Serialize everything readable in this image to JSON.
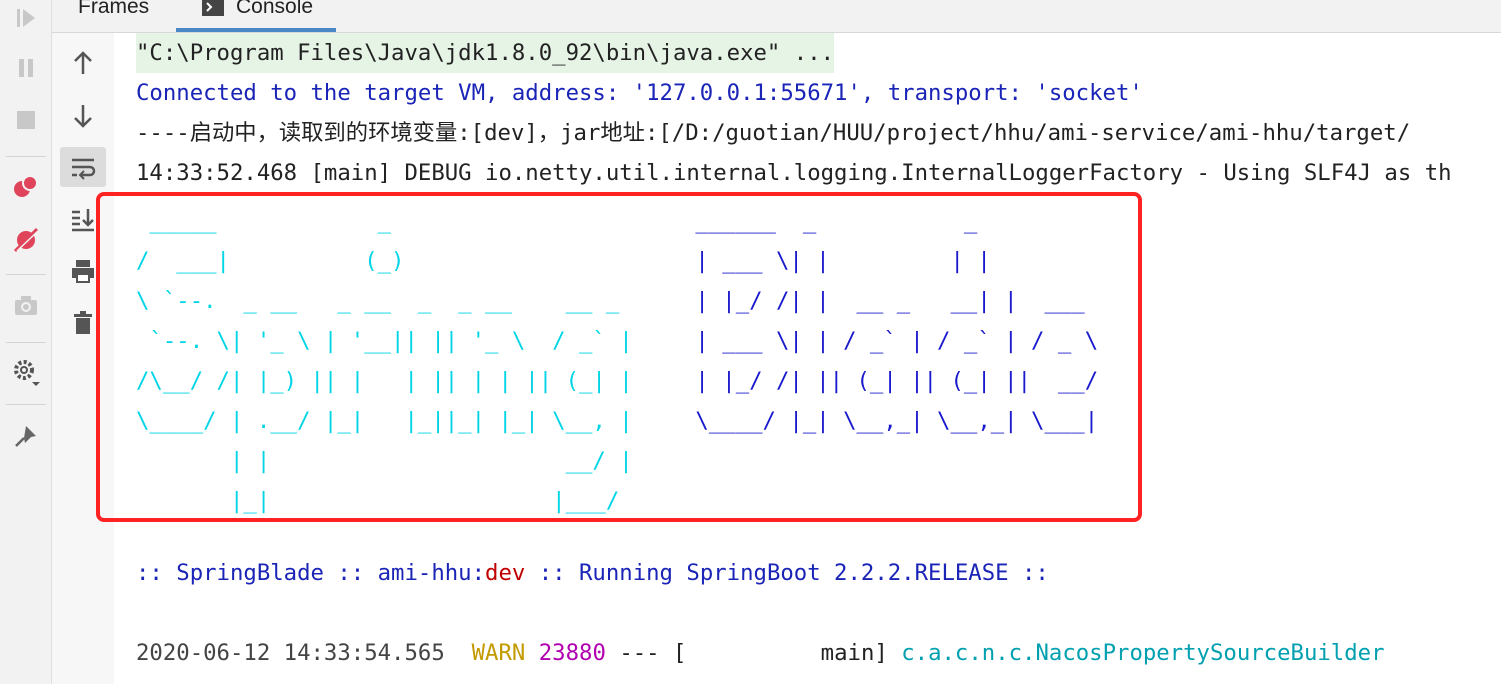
{
  "tabs": [
    {
      "label": "Frames"
    },
    {
      "label": "Console"
    }
  ],
  "toolbar_icons": [
    "resume-icon",
    "pause-icon",
    "stop-icon",
    "view-breakpoints-icon",
    "mute-breakpoints-icon",
    "camera-icon",
    "settings-icon",
    "pin-icon"
  ],
  "console_tool_icons": [
    "up-arrow-icon",
    "down-arrow-icon",
    "soft-wrap-icon",
    "scroll-to-end-icon",
    "print-icon",
    "trash-icon"
  ],
  "console": {
    "cmd": "\"C:\\Program Files\\Java\\jdk1.8.0_92\\bin\\java.exe\" ...",
    "connected": "Connected to the target VM, address: '127.0.0.1:55671', transport: 'socket'",
    "startup": "----启动中，读取到的环境变量:[dev]，jar地址:[/D:/guotian/HUU/project/hhu/ami-service/ami-hhu/target/",
    "debug": "14:33:52.468 [main] DEBUG io.netty.util.internal.logging.InternalLoggerFactory - Using SLF4J as th",
    "banner_spring": " _____            _              \n/  ___|          (_)             \n\\ `--.  _ __   _ __  _  _ __    __ _ \n `--. \\| '_ \\ | '__|| || '_ \\  / _` |\n/\\__/ /| |_) || |   | || | | || (_| |\n\\____/ | .__/ |_|   |_||_| |_| \\__, |\n       | |                      __/ |\n       |_|                     |___/ ",
    "banner_blade": " ______  _           _      \n | ___ \\| |         | |     \n | |_/ /| |  __ _   __| |  ___ \n | ___ \\| | / _` | / _` | / _ \\\n | |_/ /| || (_| || (_| ||  __/\n \\____/ |_| \\__,_| \\__,_| \\___|",
    "banner_line": {
      "prefix": ":: SpringBlade :: ami-hhu:",
      "profile": "dev",
      "suffix": " :: Running SpringBoot 2.2.2.RELEASE ::"
    },
    "log": {
      "timestamp": "2020-06-12 14:33:54.565",
      "level": "WARN",
      "pid": "23880",
      "sep": "--- [",
      "thread": "          main]",
      "logger": "c.a.c.n.c.NacosPropertySourceBuilder"
    }
  }
}
